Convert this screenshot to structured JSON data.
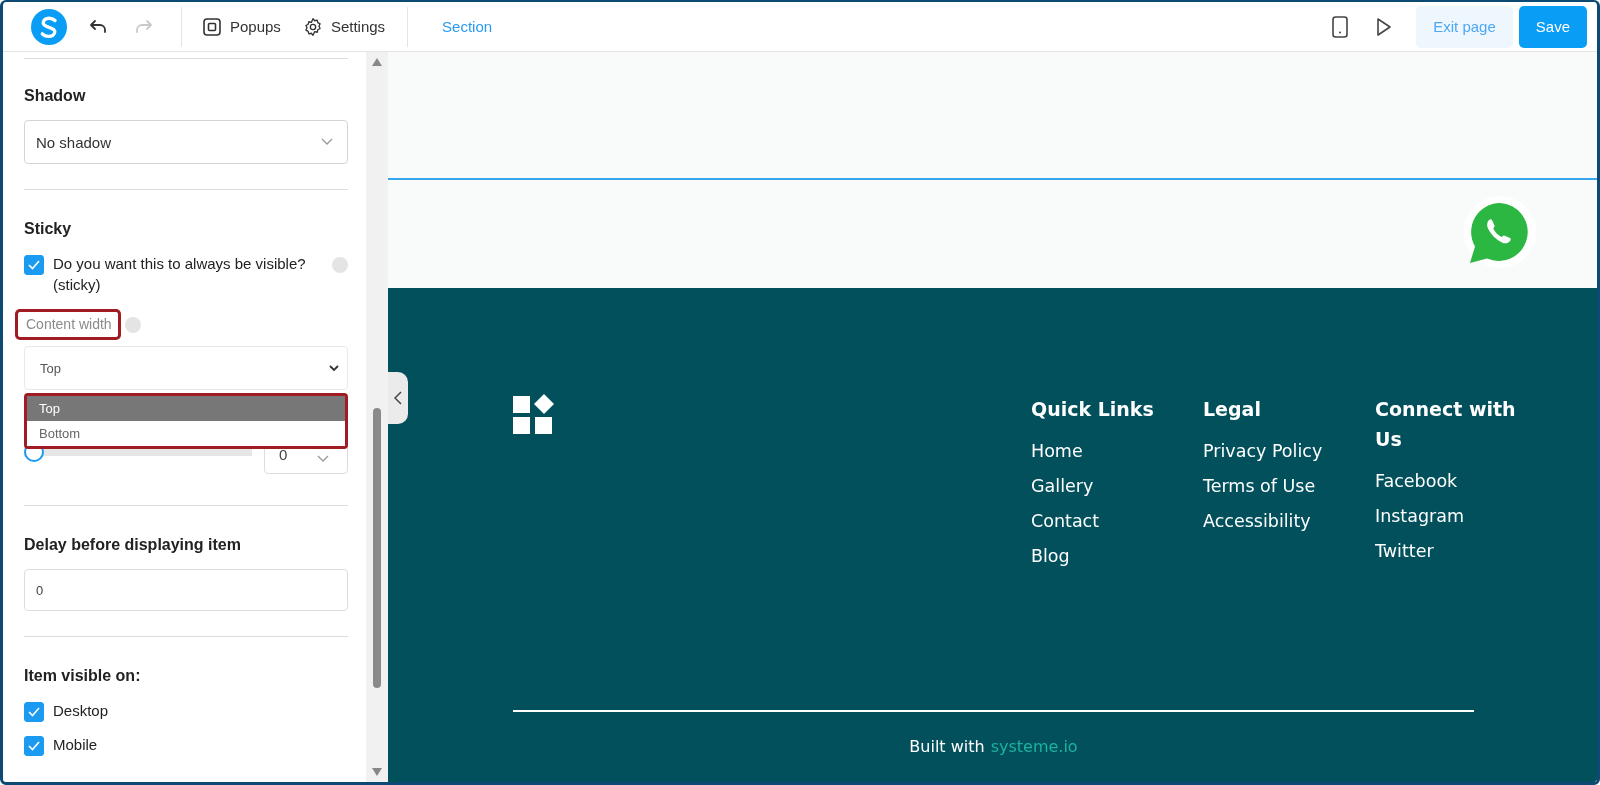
{
  "toolbar": {
    "history": [
      {
        "kind": "undo",
        "disabled": false
      },
      {
        "kind": "redo",
        "disabled": true
      }
    ],
    "menu": [
      {
        "kind": "popups",
        "label": "Popups"
      },
      {
        "kind": "settings",
        "label": "Settings"
      }
    ],
    "breadcrumb": "Section",
    "actions": [
      {
        "kind": "secondary",
        "label": "Exit page"
      },
      {
        "kind": "primary",
        "label": "Save"
      }
    ]
  },
  "panel": {
    "sections": [
      {
        "kind": "select",
        "title": "Shadow",
        "value": "No shadow"
      },
      {
        "kind": "sticky",
        "title": "Sticky",
        "checkbox": {
          "label": "Do you want this to always be visible? (sticky)",
          "checked": true
        },
        "field": {
          "label": "Content width",
          "annotated": true,
          "value": "Top",
          "expanded": true,
          "list_annotated": true,
          "options": [
            {
              "label": "Top",
              "selected": true
            },
            {
              "label": "Bottom",
              "selected": false
            }
          ]
        },
        "slider": {
          "level": 0,
          "value": "0"
        }
      },
      {
        "kind": "input",
        "title": "Delay before displaying item",
        "value": "0"
      },
      {
        "kind": "checks",
        "title": "Item visible on:",
        "items": [
          {
            "label": "Desktop",
            "checked": true
          },
          {
            "label": "Mobile",
            "checked": true
          }
        ]
      }
    ]
  },
  "footer": {
    "columns": [
      {
        "title": "Quick Links",
        "links": [
          "Home",
          "Gallery",
          "Contact",
          "Blog"
        ]
      },
      {
        "title": "Legal",
        "links": [
          "Privacy Policy",
          "Terms of Use",
          "Accessibility"
        ]
      },
      {
        "title": "Connect with Us",
        "links": [
          "Facebook",
          "Instagram",
          "Twitter"
        ]
      }
    ],
    "credit": {
      "text": "Built with",
      "link": "systeme.io"
    }
  }
}
